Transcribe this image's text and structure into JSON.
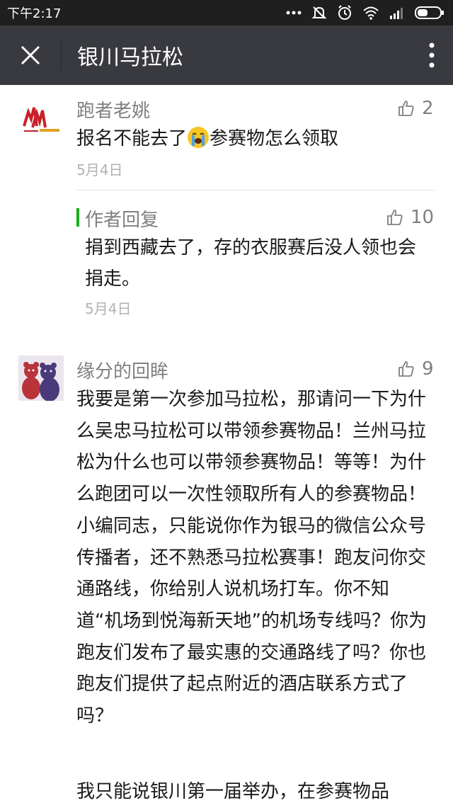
{
  "status_bar": {
    "time": "下午2:17",
    "icons": [
      "more-dots-icon",
      "mute-icon",
      "alarm-icon",
      "wifi-icon",
      "signal-icon",
      "battery-icon"
    ]
  },
  "header": {
    "title": "银川马拉松",
    "close_icon": "close-icon",
    "more_icon": "more-vertical-icon"
  },
  "comments": [
    {
      "nickname": "跑者老姚",
      "likes": "2",
      "text_before_emoji": "报名不能去了",
      "emoji": "crying-face-emoji",
      "text_after_emoji": "参赛物怎么领取",
      "date": "5月4日",
      "reply": {
        "label": "作者回复",
        "likes": "10",
        "text": "捐到西藏去了，存的衣服赛后没人领也会捐走。",
        "date": "5月4日"
      }
    },
    {
      "nickname": "缘分的回眸",
      "likes": "9",
      "paragraph1": "我要是第一次参加马拉松，那请问一下为什么吴忠马拉松可以带领参赛物品！兰州马拉松为什么也可以带领参赛物品！等等！为什么跑团可以一次性领取所有人的参赛物品！小编同志，只能说你作为银马的微信公众号传播者，还不熟悉马拉松赛事！跑友问你交通路线，你给别人说机场打车。你不知道“机场到悦海新天地”的机场专线吗？你为跑友们发布了最实惠的交通路线了吗？你也跑友们提供了起点附近的酒店联系方式了吗？",
      "paragraph2": "我只能说银川第一届举办，在参赛物品"
    }
  ],
  "colors": {
    "status_bar": "#1f1f1f",
    "nav_bar": "#393a3f",
    "reply_accent": "#1aad19",
    "meta_text": "#808080",
    "date_text": "#b2b2b2"
  }
}
